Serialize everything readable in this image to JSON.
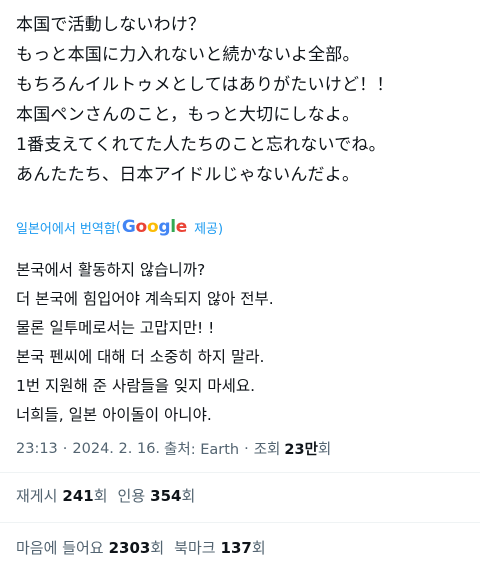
{
  "original": {
    "lines": [
      "本国で活動しないわけ？",
      "もっと本国に力入れないと続かないよ全部。",
      "もちろんイルトゥメとしてはありがたいけど！！",
      "本国ペンさんのこと，もっと大切にしなよ。",
      "1番支えてくれてた人たちのこと忘れないでね。",
      "あんたたち、日本アイドルじゃないんだよ。"
    ]
  },
  "translate": {
    "label": "일본어에서 번역함",
    "paren_open": "(",
    "google_letters": [
      "G",
      "o",
      "o",
      "g",
      "l",
      "e"
    ],
    "provider_suffix": " 제공)"
  },
  "translation": {
    "lines": [
      "본국에서 활동하지 않습니까?",
      "더 본국에 힘입어야 계속되지 않아 전부.",
      "물론 일투메로서는 고맙지만! !",
      "본국 펜씨에 대해 더 소중히 하지 말라.",
      "1번 지원해 준 사람들을 잊지 마세요.",
      "너희들, 일본 아이돌이 아니야."
    ]
  },
  "meta": {
    "time": "23:13",
    "separator": "·",
    "date": "2024. 2. 16.",
    "source": "출처: Earth",
    "views_label": "조회",
    "views_count": "23만",
    "views_unit": "회"
  },
  "stats": {
    "reposts": {
      "label": "재게시",
      "count": "241",
      "unit": "회"
    },
    "quotes": {
      "label": "인용",
      "count": "354",
      "unit": "회"
    },
    "likes": {
      "label": "마음에 들어요",
      "count": "2303",
      "unit": "회"
    },
    "bookmarks": {
      "label": "북마크",
      "count": "137",
      "unit": "회"
    }
  },
  "colors": {
    "link": "#1d9bf0",
    "text": "#0f1419",
    "muted": "#536471",
    "divider": "#eff3f4",
    "google_blue": "#4285F4",
    "google_red": "#EA4335",
    "google_yellow": "#FBBC05",
    "google_green": "#34A853"
  }
}
